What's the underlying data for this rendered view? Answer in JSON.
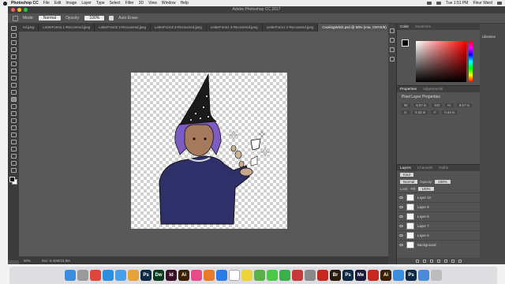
{
  "menubar": {
    "app": "Photoshop CC",
    "items": [
      "File",
      "Edit",
      "Image",
      "Layer",
      "Type",
      "Select",
      "Filter",
      "3D",
      "View",
      "Window",
      "Help"
    ],
    "clock": "Tue 1:51 PM",
    "user": "Fleur Ward"
  },
  "window": {
    "title": "Adobe Photoshop CC 2017"
  },
  "options": {
    "mode_label": "Mode:",
    "mode": "Normal",
    "opacity_label": "Opacity:",
    "opacity": "100%",
    "auto_erase": "Auto Erase"
  },
  "tabs": [
    {
      "label": "ed.jpeg"
    },
    {
      "label": "LetterForm1 1-Recovered.jpeg"
    },
    {
      "label": "LetterForm2 2-Recovered.jpeg"
    },
    {
      "label": "LetterForm2 2-Recovered.jpeg"
    },
    {
      "label": "LetterForm1 3-Recovered.jpeg"
    },
    {
      "label": "LetterForm1 2-Recovered.jpeg"
    },
    {
      "label": "CookingWitch.psd @ 50% (Ima, CMYK/8)"
    }
  ],
  "status": {
    "zoom": "50%",
    "doc": "Doc: 8.40M/23.8M"
  },
  "color_panel": {
    "tabs": [
      "Color",
      "Swatches"
    ]
  },
  "properties": {
    "tabs": [
      "Properties",
      "Adjustments"
    ],
    "header": "Pixel Layer Properties",
    "w_label": "W:",
    "w": "8.57 in",
    "go": "GO",
    "h_label": "H:",
    "h": "8.57 in",
    "x_label": "X:",
    "x": "0.02 in",
    "y_label": "Y:",
    "y": "0.44 in"
  },
  "layers_panel": {
    "tabs": [
      "Layers",
      "Channels",
      "Paths"
    ],
    "kind": "Kind",
    "blend": "Normal",
    "opacity_label": "Opacity:",
    "opacity": "100%",
    "lock_label": "Lock:",
    "fill_label": "Fill:",
    "fill": "100%",
    "layers": [
      "Layer 10",
      "Layer 9",
      "Layer 8",
      "Layer 7",
      "Layer 6",
      "Background"
    ]
  },
  "libraries": {
    "label": "Libraries"
  },
  "dock": {
    "apps": [
      {
        "name": "finder",
        "color": "#3b8de0",
        "glyph": ""
      },
      {
        "name": "launchpad",
        "color": "#9a9a9a",
        "glyph": ""
      },
      {
        "name": "chrome",
        "color": "#e0463a",
        "glyph": ""
      },
      {
        "name": "safari",
        "color": "#2a8fe0",
        "glyph": ""
      },
      {
        "name": "mail",
        "color": "#4aa0e8",
        "glyph": ""
      },
      {
        "name": "photos",
        "color": "#e8a23a",
        "glyph": ""
      },
      {
        "name": "photoshop",
        "color": "#0f2a44",
        "glyph": "Ps"
      },
      {
        "name": "dreamweaver",
        "color": "#0b3b1e",
        "glyph": "Dw"
      },
      {
        "name": "indesign",
        "color": "#3a0f2a",
        "glyph": "Id"
      },
      {
        "name": "illustrator",
        "color": "#3a2200",
        "glyph": "Ai"
      },
      {
        "name": "itunes",
        "color": "#e84a8a",
        "glyph": ""
      },
      {
        "name": "ibooks",
        "color": "#e87a2a",
        "glyph": ""
      },
      {
        "name": "app-store",
        "color": "#2a7ae8",
        "glyph": ""
      },
      {
        "name": "calendar",
        "color": "#ffffff",
        "glyph": ""
      },
      {
        "name": "notes",
        "color": "#f0d23a",
        "glyph": ""
      },
      {
        "name": "maps",
        "color": "#5ab04a",
        "glyph": ""
      },
      {
        "name": "messages",
        "color": "#4ac84a",
        "glyph": ""
      },
      {
        "name": "facetime",
        "color": "#3ab04a",
        "glyph": ""
      },
      {
        "name": "photo-booth",
        "color": "#c83a3a",
        "glyph": ""
      },
      {
        "name": "system-preferences",
        "color": "#8a8a8a",
        "glyph": ""
      },
      {
        "name": "acrobat",
        "color": "#c8281e",
        "glyph": ""
      },
      {
        "name": "bridge",
        "color": "#2a1a0a",
        "glyph": "Br"
      },
      {
        "name": "photoshop-2",
        "color": "#0f2a44",
        "glyph": "Ps"
      },
      {
        "name": "media-encoder",
        "color": "#1a1a3a",
        "glyph": "Me"
      },
      {
        "name": "acrobat-2",
        "color": "#c8281e",
        "glyph": ""
      },
      {
        "name": "illustrator-2",
        "color": "#3a2200",
        "glyph": "Ai"
      },
      {
        "name": "finder-2",
        "color": "#3b8de0",
        "glyph": ""
      },
      {
        "name": "photoshop-3",
        "color": "#0f2a44",
        "glyph": "Ps"
      },
      {
        "name": "downloads",
        "color": "#4a8ad8",
        "glyph": ""
      },
      {
        "name": "trash",
        "color": "#bcbcbc",
        "glyph": ""
      }
    ]
  }
}
